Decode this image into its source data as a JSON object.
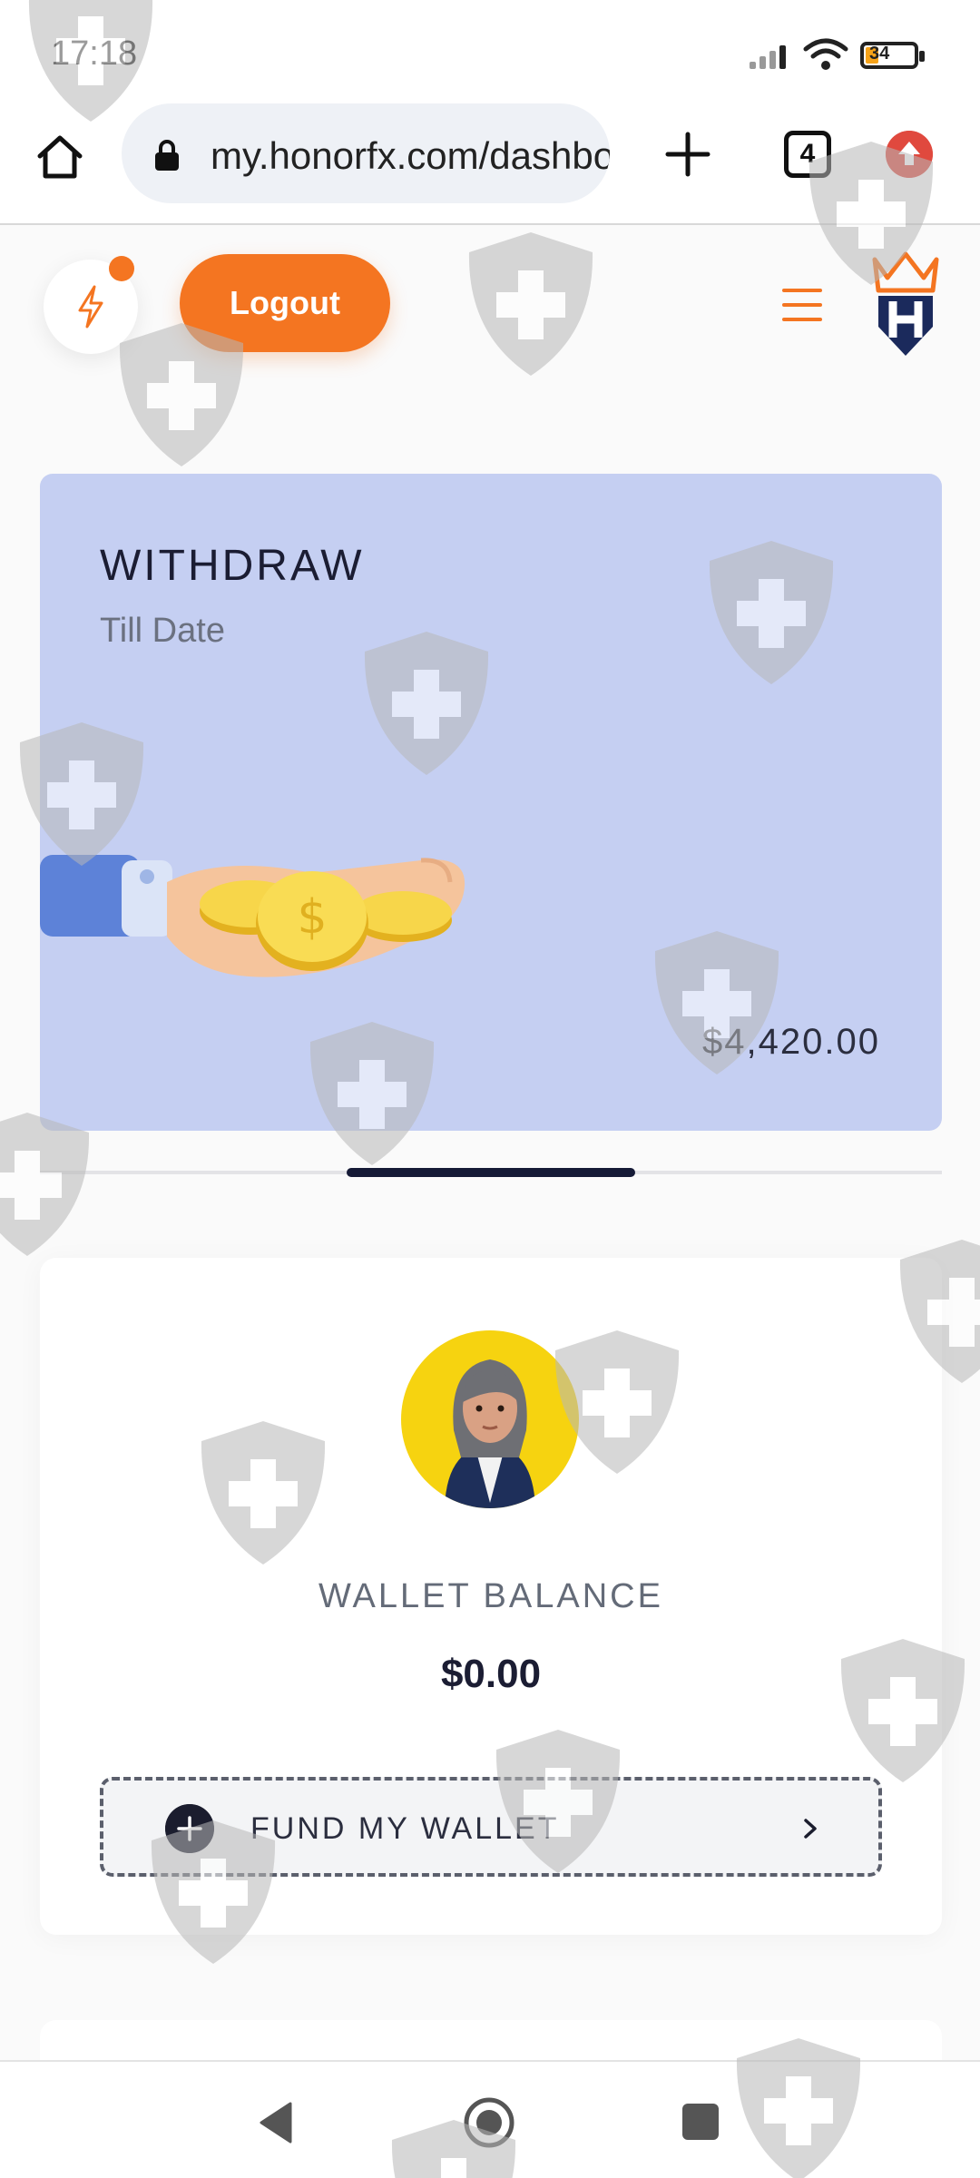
{
  "status_bar": {
    "time": "17:18",
    "battery": "34",
    "icons": [
      "signal-icon",
      "wifi-icon",
      "battery-icon"
    ]
  },
  "browser": {
    "url": "my.honorfx.com/dashboard",
    "tab_count": "4",
    "icons": [
      "home-icon",
      "lock-icon",
      "plus-icon",
      "tabs-icon",
      "update-icon"
    ]
  },
  "header": {
    "logout_label": "Logout",
    "icons": [
      "bolt-icon",
      "hamburger-menu-icon",
      "honorfx-logo"
    ]
  },
  "withdraw_card": {
    "title": "WITHDRAW",
    "subtitle": "Till Date",
    "amount": "$4,420.00",
    "background_color": "#c5cff2"
  },
  "wallet_card": {
    "label": "WALLET BALANCE",
    "amount": "$0.00",
    "fund_label": "FUND MY WALLET"
  },
  "colors": {
    "accent": "#f47521",
    "dark": "#1b1d33"
  },
  "nav_bar": {
    "icons": [
      "back-icon",
      "home-circle-icon",
      "recent-apps-icon"
    ]
  }
}
